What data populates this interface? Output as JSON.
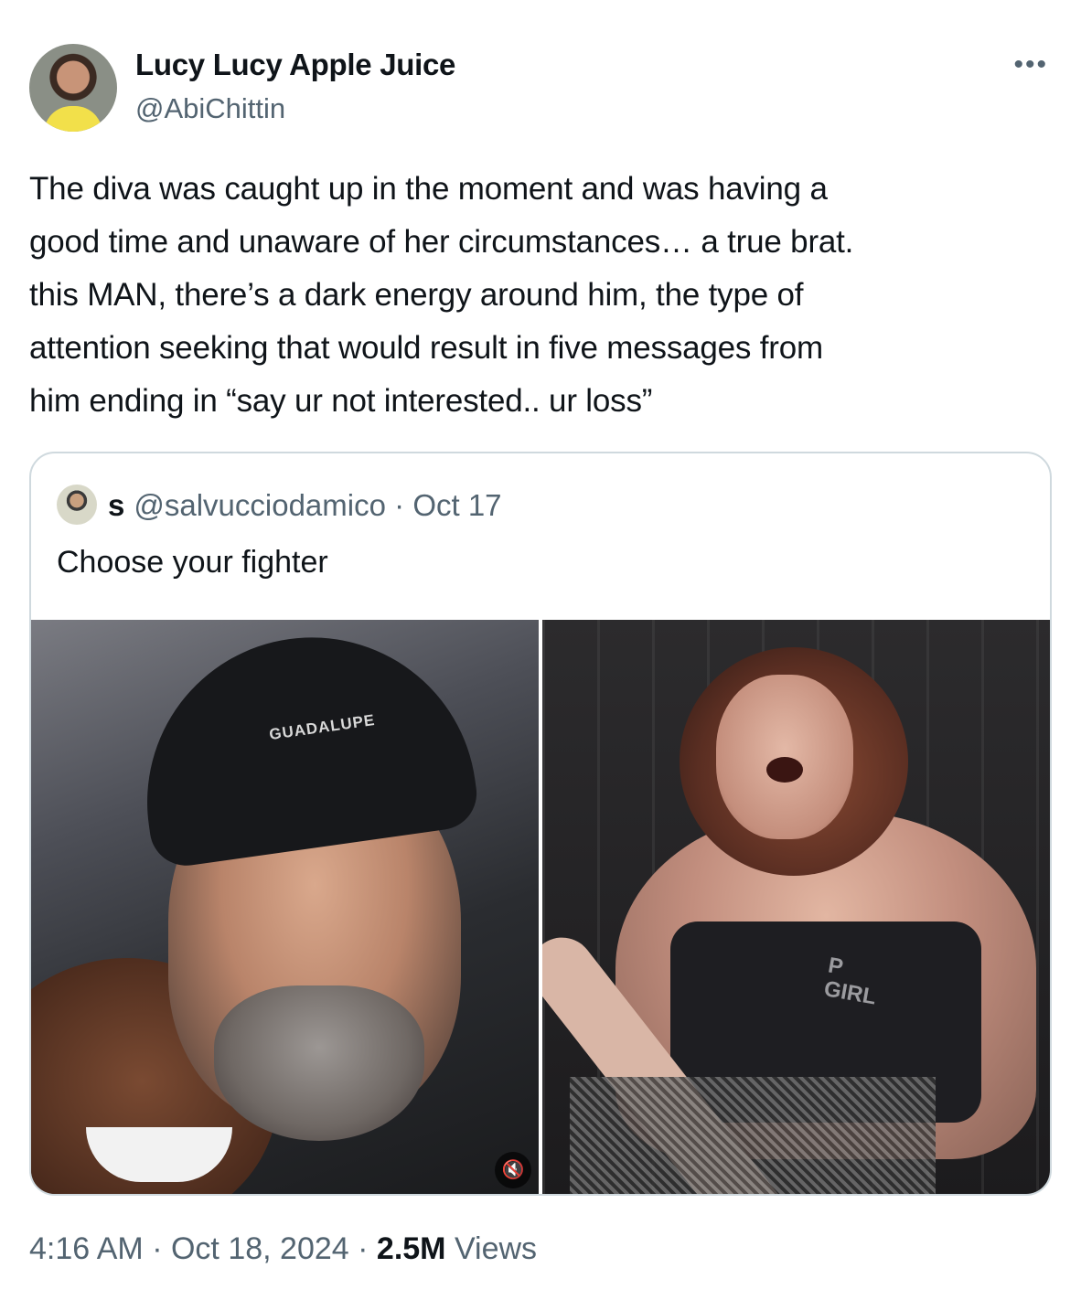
{
  "author": {
    "name": "Lucy Lucy Apple Juice",
    "handle": "@AbiChittin"
  },
  "more_label": "•••",
  "tweet": {
    "lines": [
      "The diva was caught up in the moment and was having a",
      "good time and unaware of her circumstances… a true brat.",
      "this MAN, there’s a dark energy around him, the type of",
      "attention seeking that would result in five messages from",
      "him ending in “say ur not interested.. ur loss”"
    ]
  },
  "quoted": {
    "name": "s",
    "handle": "@salvucciodamico",
    "separator": "·",
    "date": "Oct 17",
    "text": "Choose your fighter",
    "media": {
      "left_caption_cap": "GUADALUPE",
      "right_shirt_text": "P\nGIRL",
      "mute_icon": "🔇"
    }
  },
  "footer": {
    "time": "4:16 AM",
    "sep1": "·",
    "date": "Oct 18, 2024",
    "sep2": "·",
    "views_count": "2.5M",
    "views_label": "Views"
  },
  "colors": {
    "text": "#0f1419",
    "secondary": "#536471",
    "border": "#cfd9de"
  }
}
